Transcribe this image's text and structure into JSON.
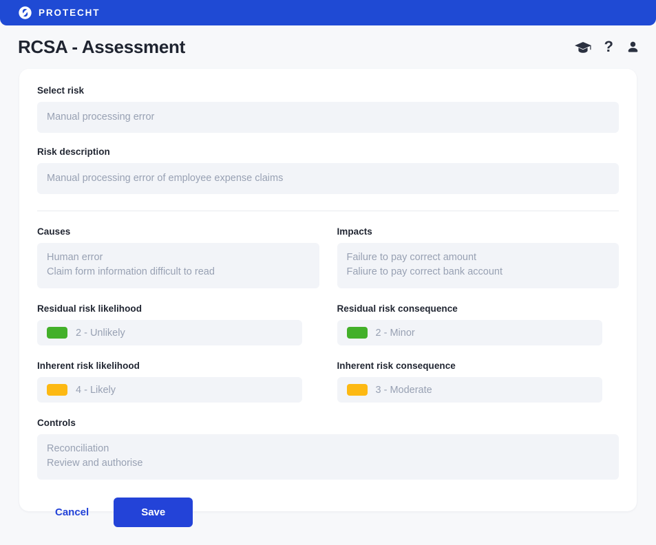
{
  "brand": {
    "name": "PROTECHT",
    "logo_icon": "protecht-swoosh-logo-icon",
    "bar_color": "#1f4ad4"
  },
  "header": {
    "title": "RCSA - Assessment",
    "icons": [
      {
        "name": "graduation-cap-icon",
        "label": "Learning"
      },
      {
        "name": "question-mark-icon",
        "label": "?"
      },
      {
        "name": "user-profile-icon",
        "label": "Account"
      }
    ]
  },
  "form": {
    "select_risk": {
      "label": "Select risk",
      "value": "Manual processing error"
    },
    "risk_description": {
      "label": "Risk description",
      "value": "Manual processing error of employee expense claims"
    },
    "causes": {
      "label": "Causes",
      "items": [
        "Human error",
        "Claim form information difficult to read"
      ]
    },
    "impacts": {
      "label": "Impacts",
      "items": [
        "Failure to pay correct amount",
        "Faliure to pay correct bank account"
      ]
    },
    "residual_risk_likelihood": {
      "label": "Residual risk likelihood",
      "value": "2 - Unlikely",
      "color": "#43b02a"
    },
    "residual_risk_consequence": {
      "label": "Residual risk consequence",
      "value": "2 - Minor",
      "color": "#43b02a"
    },
    "inherent_risk_likelihood": {
      "label": "Inherent risk likelihood",
      "value": "4 - Likely",
      "color": "#fdb913"
    },
    "inherent_risk_consequence": {
      "label": "Inherent risk consequence",
      "value": "3 - Moderate",
      "color": "#fdb913"
    },
    "controls": {
      "label": "Controls",
      "items": [
        "Reconciliation",
        "Review and authorise"
      ]
    }
  },
  "actions": {
    "cancel_label": "Cancel",
    "save_label": "Save",
    "primary_color": "#2343d8"
  }
}
